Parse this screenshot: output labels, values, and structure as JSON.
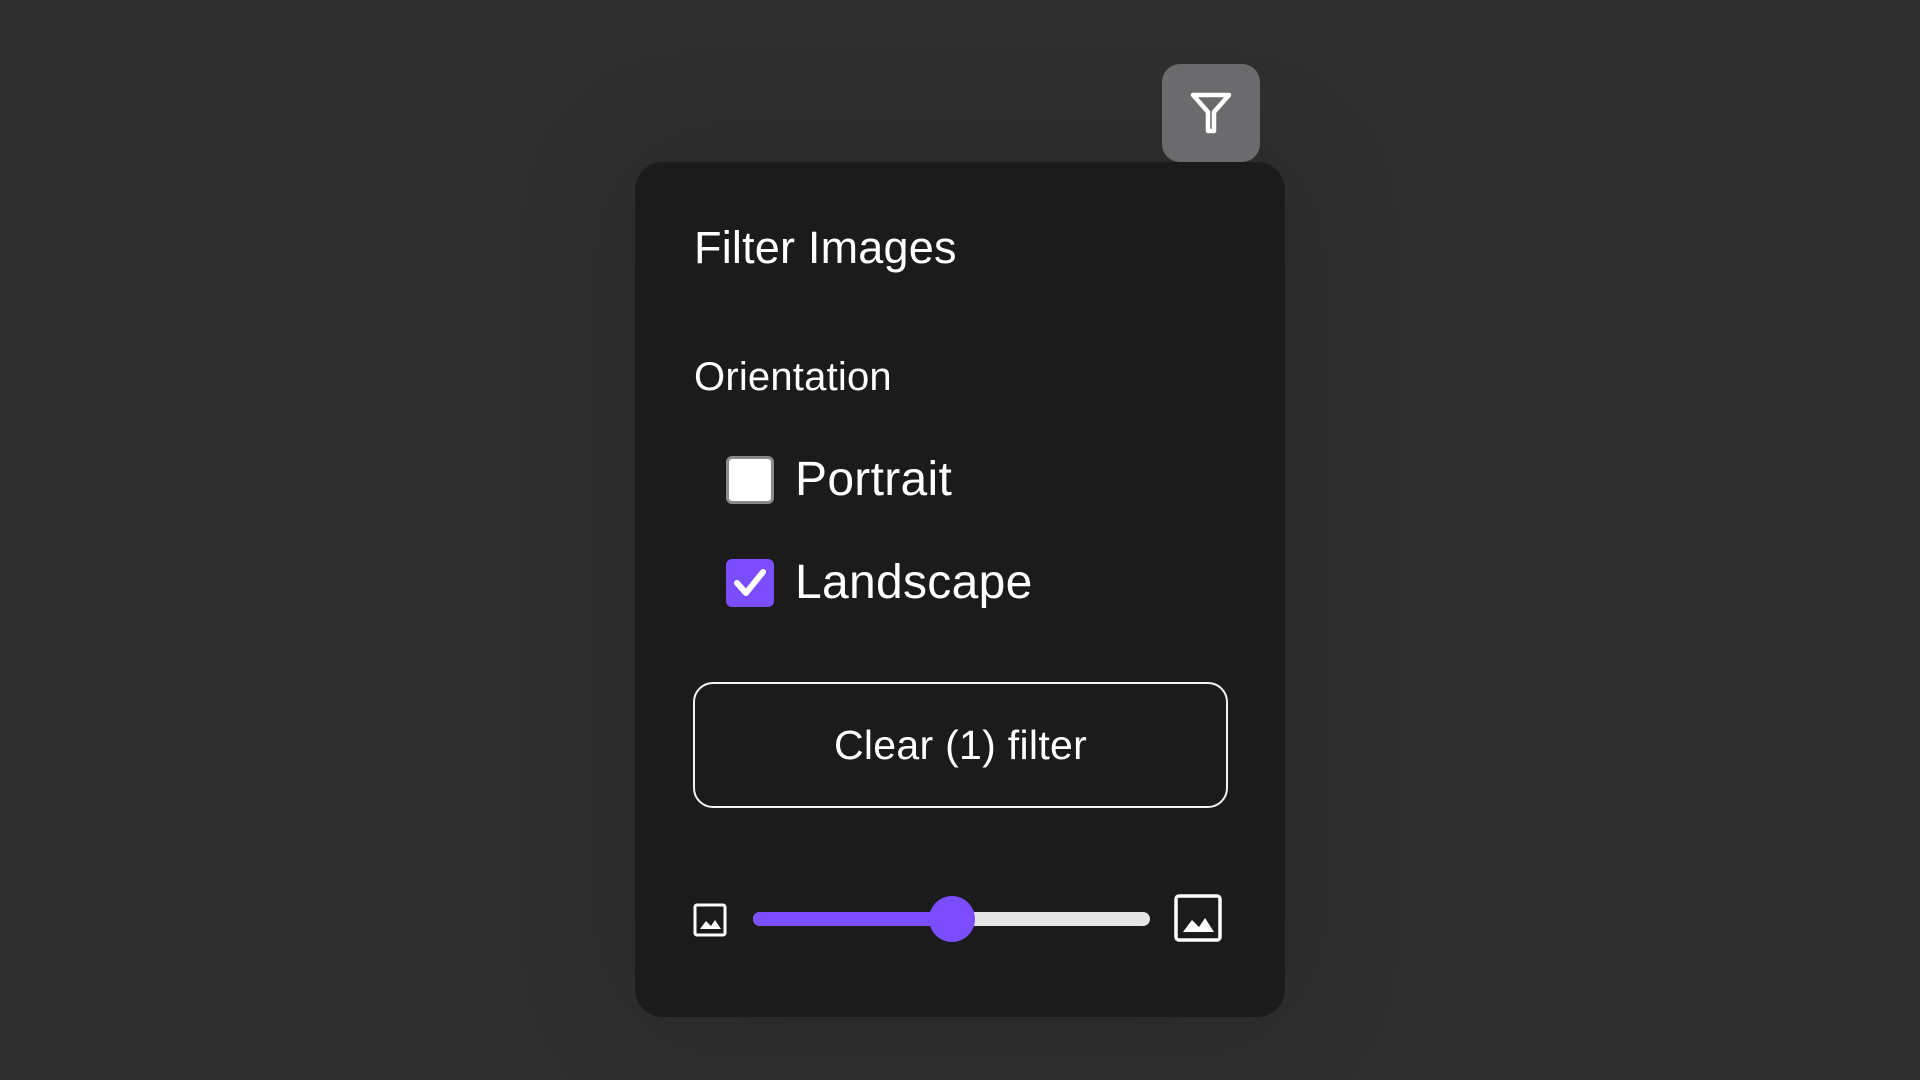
{
  "panel": {
    "title": "Filter Images",
    "orientation": {
      "heading": "Orientation",
      "options": [
        {
          "label": "Portrait",
          "checked": false
        },
        {
          "label": "Landscape",
          "checked": true
        }
      ]
    },
    "clear_button_label": "Clear (1) filter",
    "thumbnail_size": {
      "min_icon": "image-small-icon",
      "max_icon": "image-large-icon",
      "value_fraction": 0.5
    }
  },
  "filter_toggle_icon": "filter-funnel-icon",
  "colors": {
    "accent": "#7c4dff",
    "panel_background": "#1b1b1c",
    "page_background": "#2f2f30",
    "toggle_background": "#6b6b6d"
  }
}
